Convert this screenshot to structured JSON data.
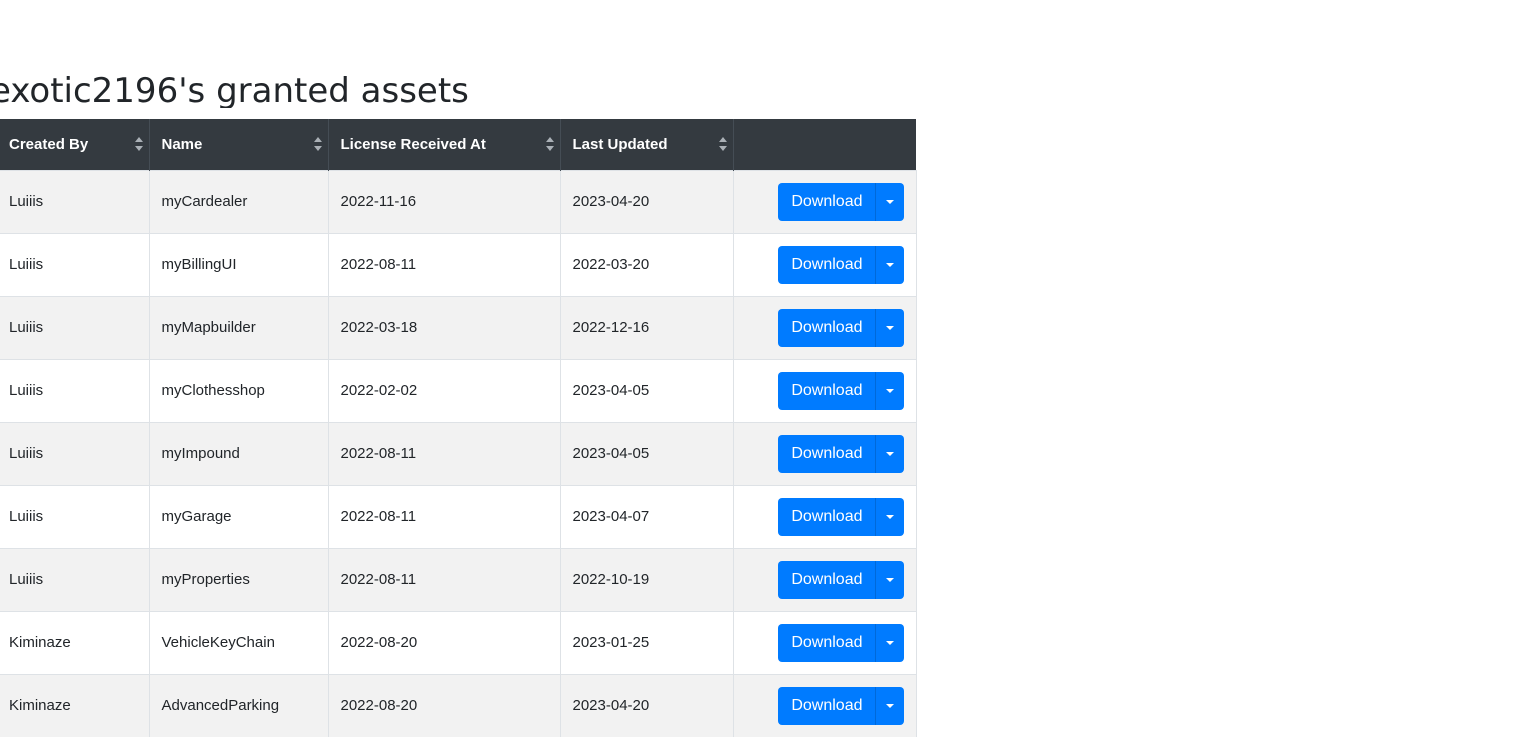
{
  "page": {
    "title": "exotic2196's granted assets"
  },
  "table": {
    "headers": [
      "Created By",
      "Name",
      "License Received At",
      "Last Updated",
      ""
    ],
    "rows": [
      {
        "created_by": "Luiiis",
        "name": "myCardealer",
        "license_received_at": "2022-11-16",
        "last_updated": "2023-04-20",
        "action": "Download"
      },
      {
        "created_by": "Luiiis",
        "name": "myBillingUI",
        "license_received_at": "2022-08-11",
        "last_updated": "2022-03-20",
        "action": "Download"
      },
      {
        "created_by": "Luiiis",
        "name": "myMapbuilder",
        "license_received_at": "2022-03-18",
        "last_updated": "2022-12-16",
        "action": "Download"
      },
      {
        "created_by": "Luiiis",
        "name": "myClothesshop",
        "license_received_at": "2022-02-02",
        "last_updated": "2023-04-05",
        "action": "Download"
      },
      {
        "created_by": "Luiiis",
        "name": "myImpound",
        "license_received_at": "2022-08-11",
        "last_updated": "2023-04-05",
        "action": "Download"
      },
      {
        "created_by": "Luiiis",
        "name": "myGarage",
        "license_received_at": "2022-08-11",
        "last_updated": "2023-04-07",
        "action": "Download"
      },
      {
        "created_by": "Luiiis",
        "name": "myProperties",
        "license_received_at": "2022-08-11",
        "last_updated": "2022-10-19",
        "action": "Download"
      },
      {
        "created_by": "Kiminaze",
        "name": "VehicleKeyChain",
        "license_received_at": "2022-08-20",
        "last_updated": "2023-01-25",
        "action": "Download"
      },
      {
        "created_by": "Kiminaze",
        "name": "AdvancedParking",
        "license_received_at": "2022-08-20",
        "last_updated": "2023-04-20",
        "action": "Download"
      }
    ]
  },
  "colors": {
    "header_bg": "#343a40",
    "primary": "#007bff",
    "row_striped": "#f2f2f2"
  },
  "icons": {
    "sort": "sort-icon",
    "dropdown": "caret-down-icon"
  }
}
